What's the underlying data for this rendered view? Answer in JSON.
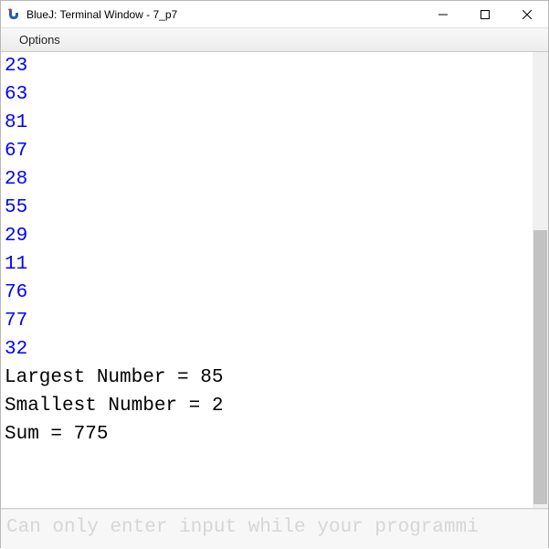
{
  "window": {
    "title": "BlueJ: Terminal Window - 7_p7",
    "controls": {
      "minimize": "—",
      "maximize": "□",
      "close": "✕"
    }
  },
  "menubar": {
    "options": "Options"
  },
  "terminal": {
    "input_lines": [
      "23",
      "63",
      "81",
      "67",
      "28",
      "55",
      "29",
      "11",
      "76",
      "77",
      "32"
    ],
    "output_lines": [
      "Largest Number = 85",
      "Smallest Number = 2",
      "Sum = 775"
    ]
  },
  "input_hint": "Can only enter input while your programmi"
}
